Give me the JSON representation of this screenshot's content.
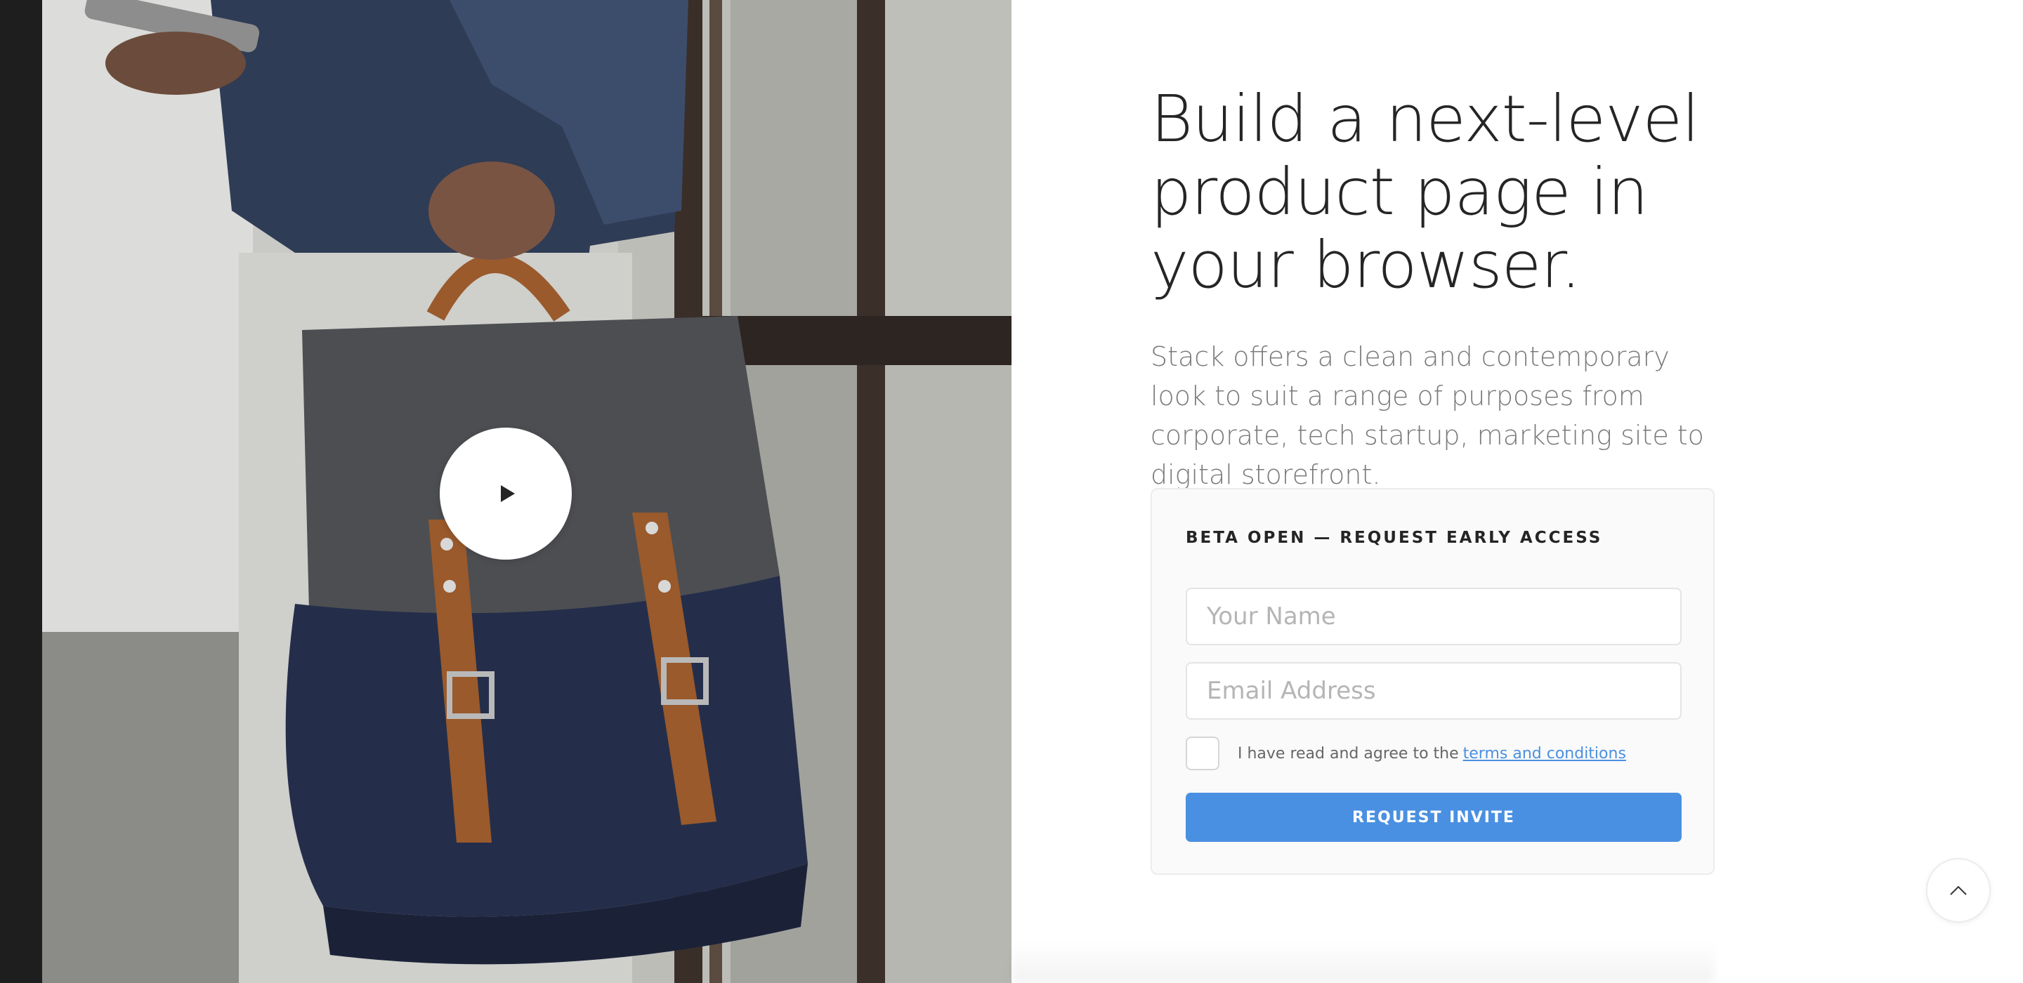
{
  "hero": {
    "play_icon": "play-icon"
  },
  "headline": "Build a next-level product page in your browser.",
  "lead": "Stack offers a clean and contemporary look to suit a range of purposes from corporate, tech startup, marketing site to digital storefront.",
  "signup": {
    "title": "BETA OPEN — REQUEST EARLY ACCESS",
    "name_placeholder": "Your Name",
    "email_placeholder": "Email Address",
    "agree_text": "I have read and agree to the",
    "agree_link": "terms and conditions",
    "submit_label": "REQUEST INVITE"
  },
  "back_to_top_icon": "chevron-up-icon",
  "colors": {
    "accent": "#4a90e2",
    "heading": "#252525",
    "body_text": "#7a7a7a",
    "box_bg": "#fafafa"
  }
}
